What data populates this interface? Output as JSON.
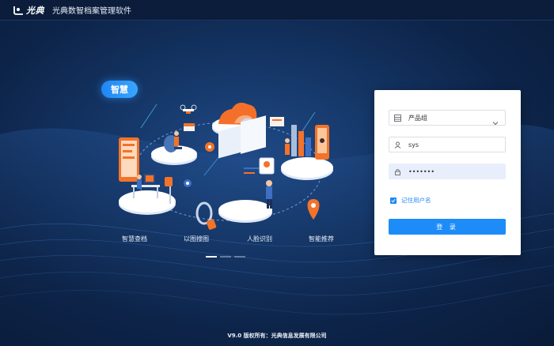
{
  "header": {
    "logo_text": "光典",
    "app_title": "光典数智档案管理软件"
  },
  "hero": {
    "badge": "智慧",
    "features": [
      "智慧查档",
      "以图搜图",
      "人脸识别",
      "智能推荐"
    ],
    "carousel_count": 3,
    "carousel_active_index": 0
  },
  "login": {
    "product_select": {
      "value": "产品组"
    },
    "username": {
      "value": "sys"
    },
    "password": {
      "value": "•••••••"
    },
    "remember_label": "记住用户名",
    "remember_checked": true,
    "submit_label": "登 录"
  },
  "footer": {
    "copyright": "V9.0 版权所有：光典信息发展有限公司"
  },
  "colors": {
    "accent": "#1e8cf8",
    "background": "#0c1f3f",
    "orange": "#f2701e"
  },
  "icons": {
    "select": "building-icon",
    "username": "user-icon",
    "password": "lock-icon",
    "dropdown": "chevron-down-icon"
  }
}
